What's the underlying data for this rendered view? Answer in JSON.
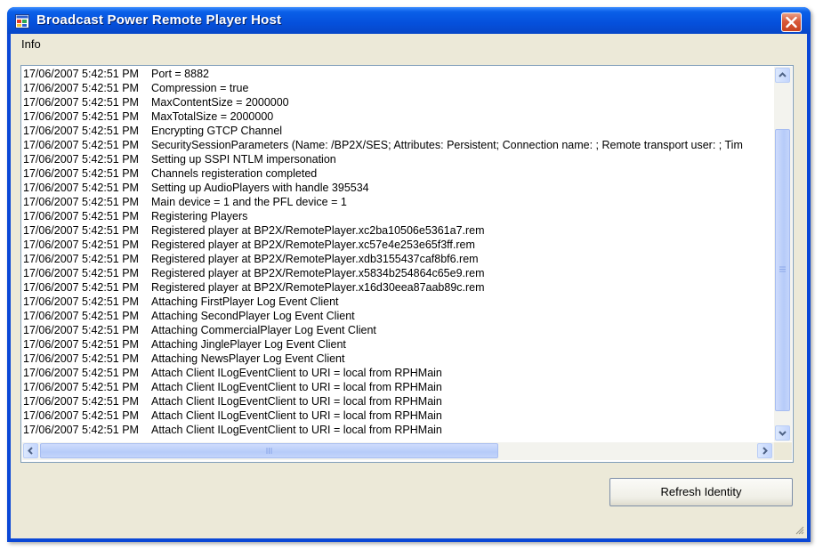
{
  "window": {
    "title": "Broadcast Power Remote Player Host"
  },
  "menu": {
    "items": [
      {
        "label": "Info"
      }
    ]
  },
  "log": {
    "rows": [
      {
        "time": "17/06/2007 5:42:51 PM",
        "message": "Port = 8882"
      },
      {
        "time": "17/06/2007 5:42:51 PM",
        "message": "Compression = true"
      },
      {
        "time": "17/06/2007 5:42:51 PM",
        "message": "MaxContentSize = 2000000"
      },
      {
        "time": "17/06/2007 5:42:51 PM",
        "message": "MaxTotalSize = 2000000"
      },
      {
        "time": "17/06/2007 5:42:51 PM",
        "message": "Encrypting GTCP Channel"
      },
      {
        "time": "17/06/2007 5:42:51 PM",
        "message": "SecuritySessionParameters (Name: /BP2X/SES; Attributes: Persistent; Connection name: ; Remote transport user: ; Tim"
      },
      {
        "time": "17/06/2007 5:42:51 PM",
        "message": "Setting up SSPI NTLM impersonation"
      },
      {
        "time": "17/06/2007 5:42:51 PM",
        "message": "Channels registeration completed"
      },
      {
        "time": "17/06/2007 5:42:51 PM",
        "message": "Setting up AudioPlayers with handle 395534"
      },
      {
        "time": "17/06/2007 5:42:51 PM",
        "message": "Main device = 1 and the PFL device = 1"
      },
      {
        "time": "17/06/2007 5:42:51 PM",
        "message": "Registering Players"
      },
      {
        "time": "17/06/2007 5:42:51 PM",
        "message": "Registered player at BP2X/RemotePlayer.xc2ba10506e5361a7.rem"
      },
      {
        "time": "17/06/2007 5:42:51 PM",
        "message": "Registered player at BP2X/RemotePlayer.xc57e4e253e65f3ff.rem"
      },
      {
        "time": "17/06/2007 5:42:51 PM",
        "message": "Registered player at BP2X/RemotePlayer.xdb3155437caf8bf6.rem"
      },
      {
        "time": "17/06/2007 5:42:51 PM",
        "message": "Registered player at BP2X/RemotePlayer.x5834b254864c65e9.rem"
      },
      {
        "time": "17/06/2007 5:42:51 PM",
        "message": "Registered player at BP2X/RemotePlayer.x16d30eea87aab89c.rem"
      },
      {
        "time": "17/06/2007 5:42:51 PM",
        "message": "Attaching FirstPlayer Log Event Client"
      },
      {
        "time": "17/06/2007 5:42:51 PM",
        "message": "Attaching SecondPlayer Log Event Client"
      },
      {
        "time": "17/06/2007 5:42:51 PM",
        "message": "Attaching CommercialPlayer Log Event Client"
      },
      {
        "time": "17/06/2007 5:42:51 PM",
        "message": "Attaching JinglePlayer Log Event Client"
      },
      {
        "time": "17/06/2007 5:42:51 PM",
        "message": "Attaching NewsPlayer Log Event Client"
      },
      {
        "time": "17/06/2007 5:42:51 PM",
        "message": "Attach Client ILogEventClient to URI = local from RPHMain"
      },
      {
        "time": "17/06/2007 5:42:51 PM",
        "message": "Attach Client ILogEventClient to URI = local from RPHMain"
      },
      {
        "time": "17/06/2007 5:42:51 PM",
        "message": "Attach Client ILogEventClient to URI = local from RPHMain"
      },
      {
        "time": "17/06/2007 5:42:51 PM",
        "message": "Attach Client ILogEventClient to URI = local from RPHMain"
      },
      {
        "time": "17/06/2007 5:42:51 PM",
        "message": "Attach Client ILogEventClient to URI = local from RPHMain"
      }
    ],
    "vertical_scroll_position": 1.0,
    "horizontal_scroll_position": 0.0
  },
  "buttons": {
    "refresh_identity": "Refresh Identity"
  },
  "colors": {
    "titlebar": "#0550dc",
    "close_button": "#d9593a",
    "client_bg": "#ece9d8",
    "scrollbar_thumb": "#b6cbf9"
  },
  "icons": {
    "app": "app-window-icon",
    "close": "close-x-icon",
    "scroll_up": "arrow-up-icon",
    "scroll_down": "arrow-down-icon",
    "scroll_left": "arrow-left-icon",
    "scroll_right": "arrow-right-icon",
    "grip": "size-grip-icon"
  }
}
